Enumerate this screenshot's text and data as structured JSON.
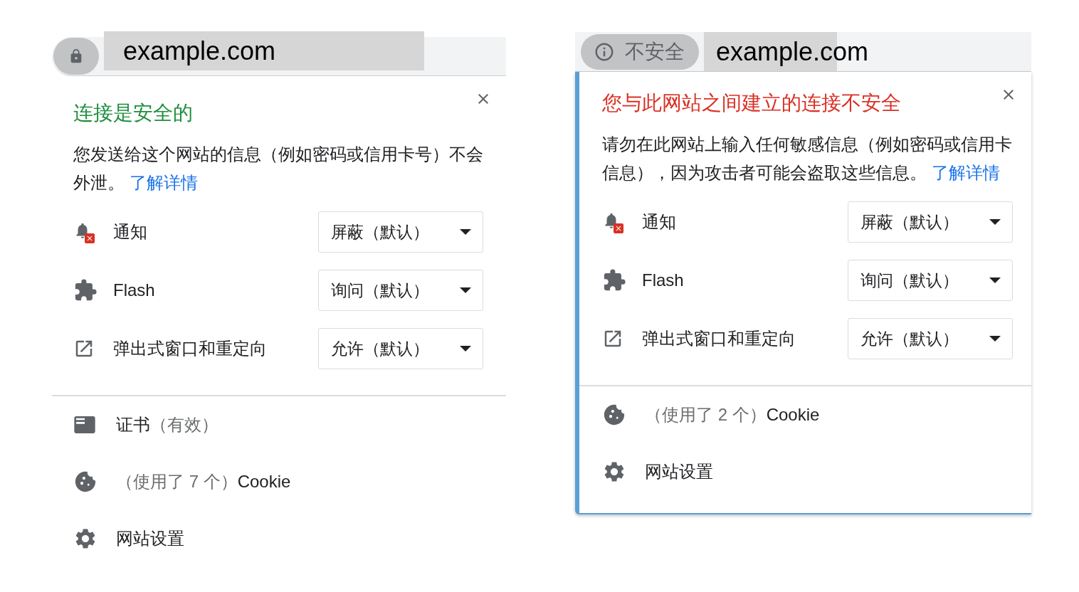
{
  "panels": [
    {
      "kind": "secure",
      "address_bar": {
        "url": "example.com"
      },
      "title": "连接是安全的",
      "description": "您发送给这个网站的信息（例如密码或信用卡号）不会外泄。",
      "link": "了解详情",
      "permissions": [
        {
          "kind": "notifications",
          "label": "通知",
          "value": "屏蔽（默认）"
        },
        {
          "kind": "plugin",
          "label": "Flash",
          "value": "询问（默认）"
        },
        {
          "kind": "popups",
          "label": "弹出式窗口和重定向",
          "value": "允许（默认）"
        }
      ],
      "links": [
        {
          "kind": "certificate",
          "parts": [
            {
              "text": "证书",
              "muted": false
            },
            {
              "text": "（有效）",
              "muted": true
            }
          ]
        },
        {
          "kind": "cookies",
          "parts": [
            {
              "text": "（使用了 7 个）",
              "muted": true
            },
            {
              "text": "Cookie",
              "muted": false
            }
          ]
        },
        {
          "kind": "settings",
          "parts": [
            {
              "text": "网站设置",
              "muted": false
            }
          ]
        }
      ]
    },
    {
      "kind": "insecure",
      "address_bar": {
        "badge": "不安全",
        "url": "example.com"
      },
      "title": "您与此网站之间建立的连接不安全",
      "description": "请勿在此网站上输入任何敏感信息（例如密码或信用卡信息），因为攻击者可能会盗取这些信息。",
      "link": "了解详情",
      "permissions": [
        {
          "kind": "notifications",
          "label": "通知",
          "value": "屏蔽（默认）"
        },
        {
          "kind": "plugin",
          "label": "Flash",
          "value": "询问（默认）"
        },
        {
          "kind": "popups",
          "label": "弹出式窗口和重定向",
          "value": "允许（默认）"
        }
      ],
      "links": [
        {
          "kind": "cookies",
          "parts": [
            {
              "text": "（使用了 2 个）",
              "muted": true
            },
            {
              "text": "Cookie",
              "muted": false
            }
          ]
        },
        {
          "kind": "settings",
          "parts": [
            {
              "text": "网站设置",
              "muted": false
            }
          ]
        }
      ]
    }
  ]
}
